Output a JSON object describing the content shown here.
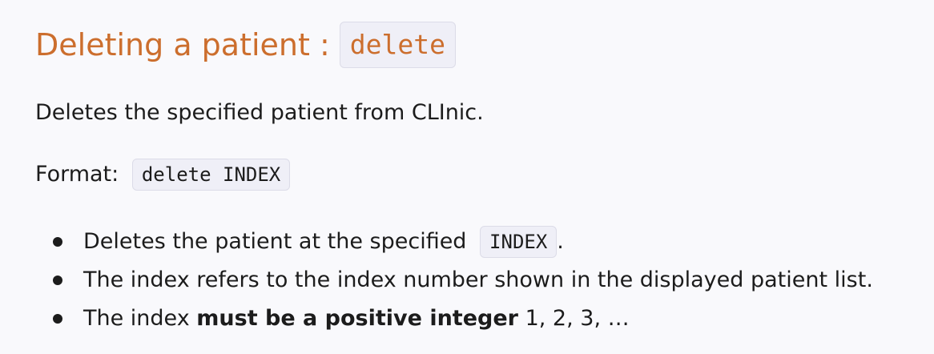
{
  "heading": {
    "title": "Deleting a patient :",
    "command": "delete"
  },
  "description": "Deletes the specified patient from CLInic.",
  "format": {
    "label": "Format:",
    "syntax": "delete INDEX"
  },
  "bullets": [
    {
      "text_before": "Deletes the patient at the specified",
      "code": "INDEX",
      "text_after": "."
    },
    {
      "text": "The index refers to the index number shown in the displayed patient list."
    },
    {
      "text_before": "The index",
      "bold": "must be a positive integer",
      "text_after": "1, 2, 3, …"
    }
  ],
  "colors": {
    "heading": "#cc6e2d",
    "background": "#f9f9fc",
    "code_background": "#efeff7"
  }
}
